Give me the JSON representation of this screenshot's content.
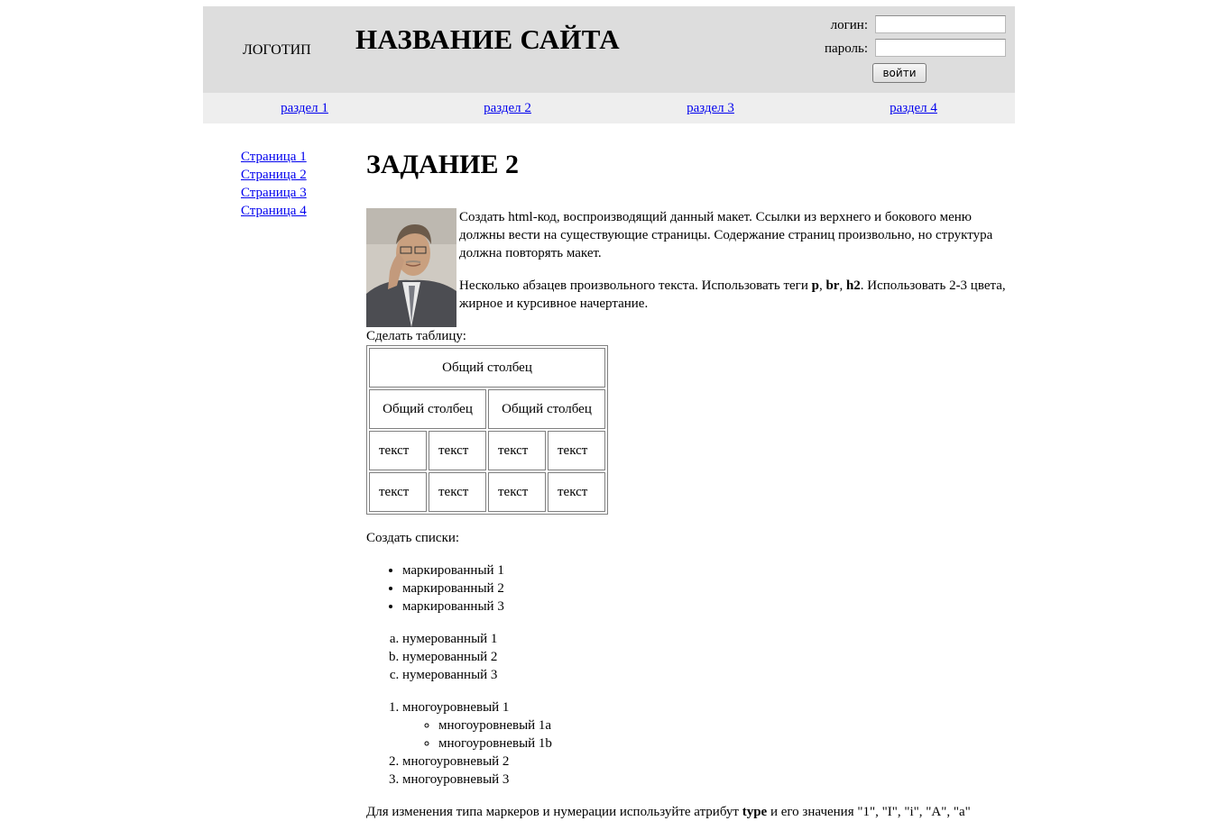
{
  "header": {
    "logo": "ЛОГОТИП",
    "site_title": "НАЗВАНИЕ САЙТА",
    "login_label": "логин:",
    "password_label": "пароль:",
    "login_button": "войти"
  },
  "nav": {
    "items": [
      {
        "label": "раздел 1"
      },
      {
        "label": "раздел 2"
      },
      {
        "label": "раздел 3"
      },
      {
        "label": "раздел 4"
      }
    ]
  },
  "sidebar": {
    "items": [
      {
        "label": "Страница 1"
      },
      {
        "label": "Страница 2"
      },
      {
        "label": "Страница 3"
      },
      {
        "label": "Страница 4"
      }
    ]
  },
  "main": {
    "title": "ЗАДАНИЕ 2",
    "intro": {
      "p1": "Создать html-код, воспроизводящий данный макет. Ссылки из верхнего и бокового меню должны вести на существующие страницы. Содержание страниц произвольно, но структура должна повторять макет.",
      "p2_start": "Несколько абзацев произвольного текста. Использовать теги ",
      "tag_p": "p",
      "sep1": ", ",
      "tag_br": "br",
      "sep2": ", ",
      "tag_h2": "h2",
      "p2_end": ". Использовать 2-3 цвета, жирное и курсивное начертание."
    },
    "table_caption": "Сделать таблицу:",
    "table": {
      "header_full": "Общий столбец",
      "header_left": "Общий столбец",
      "header_right": "Общий столбец",
      "rows": [
        [
          "текст",
          "текст",
          "текст",
          "текст"
        ],
        [
          "текст",
          "текст",
          "текст",
          "текст"
        ]
      ]
    },
    "lists_caption": "Создать списки:",
    "bulleted": [
      "маркированный 1",
      "маркированный 2",
      "маркированный 3"
    ],
    "numbered": [
      "нумерованный 1",
      "нумерованный 2",
      "нумерованный 3"
    ],
    "multilevel": {
      "item1": "многоуровневый 1",
      "sub": [
        "многоуровневый 1a",
        "многоуровневый 1b"
      ],
      "item2": "многоуровневый 2",
      "item3": "многоуровневый 3"
    },
    "note": {
      "start": "Для изменения типа маркеров и нумерации используйте атрибут ",
      "attr": "type",
      "end": " и его значения \"1\", \"I\", \"i\", \"A\", \"a\""
    }
  },
  "photo_icon": "portrait-photo-icon"
}
